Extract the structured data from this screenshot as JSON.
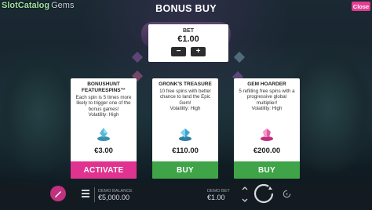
{
  "header": {
    "watermark": "SlotCatalog",
    "game_suffix": "Gems",
    "title": "BONUS BUY",
    "close_label": "Close"
  },
  "bet": {
    "label": "BET",
    "value": "€1.00",
    "minus": "−",
    "plus": "+"
  },
  "options": [
    {
      "title": "BONUSHUNT FEATURESPINS™",
      "description": "Each spin is 5 times more likely to trigger one of the bonus games!",
      "volatility": "Volatility: High",
      "price": "€3.00",
      "action": "ACTIVATE",
      "action_color": "#e0328f",
      "icon": "spin-feature-icon"
    },
    {
      "title": "GRONK'S TREASURE",
      "description": "10 free spins with better chance to land the Epic Gem!",
      "volatility": "Volatility: High",
      "price": "€110.00",
      "action": "BUY",
      "action_color": "#3fa348",
      "icon": "blue-gem-icon"
    },
    {
      "title": "GEM HOARDER",
      "description": "5 refilling free spins with a progressive global multiplier!",
      "volatility": "Volatility: High",
      "price": "€200.00",
      "action": "BUY",
      "action_color": "#3fa348",
      "icon": "pink-gem-icon"
    }
  ],
  "footer": {
    "balance_label": "DEMO BALANCE",
    "balance_value": "€5,000.00",
    "bet_label": "DEMO BET",
    "bet_value": "€1.00"
  },
  "colors": {
    "accent_pink": "#e0328f",
    "accent_green": "#3fa348",
    "close_pink": "#e23c93"
  }
}
